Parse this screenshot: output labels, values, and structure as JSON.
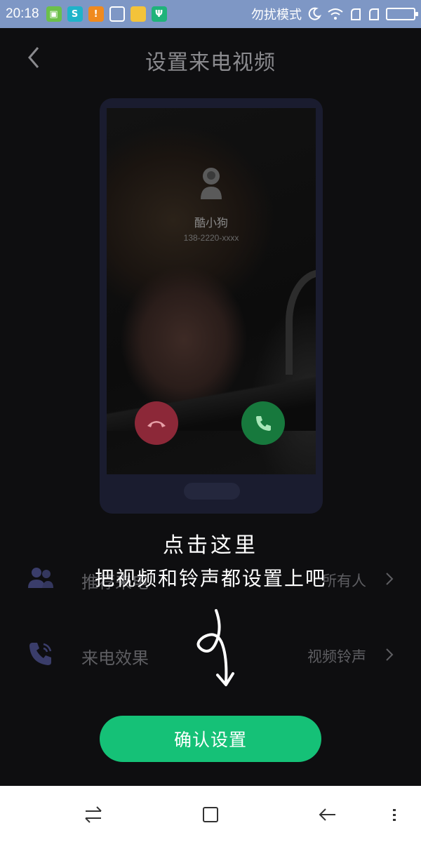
{
  "status_bar": {
    "time": "20:18",
    "mode_text": "勿扰模式",
    "notification_icons": [
      "app-icon",
      "sync-icon",
      "warning-icon",
      "brush-icon",
      "folder-icon",
      "usb-icon"
    ],
    "system_icons": [
      "moon-icon",
      "wifi-icon",
      "signal-icon",
      "signal-icon",
      "battery-icon"
    ]
  },
  "header": {
    "title": "设置来电视频"
  },
  "preview": {
    "caller_name": "酷小狗",
    "caller_number": "138-2220-xxxx"
  },
  "settings": {
    "rows": [
      {
        "label": "推荐来电",
        "value": "所有人",
        "icon": "contacts-icon"
      },
      {
        "label": "来电效果",
        "value": "视频铃声",
        "icon": "phone-ringing-icon"
      }
    ]
  },
  "hint": {
    "line1": "点击这里",
    "line2": "把视频和铃声都设置上吧"
  },
  "confirm_button": {
    "label": "确认设置"
  },
  "colors": {
    "background": "#0e0e10",
    "status_bar": "#7e97c5",
    "accent_green": "#15c177",
    "decline_red": "#8c2838",
    "accept_green": "#17793d"
  }
}
